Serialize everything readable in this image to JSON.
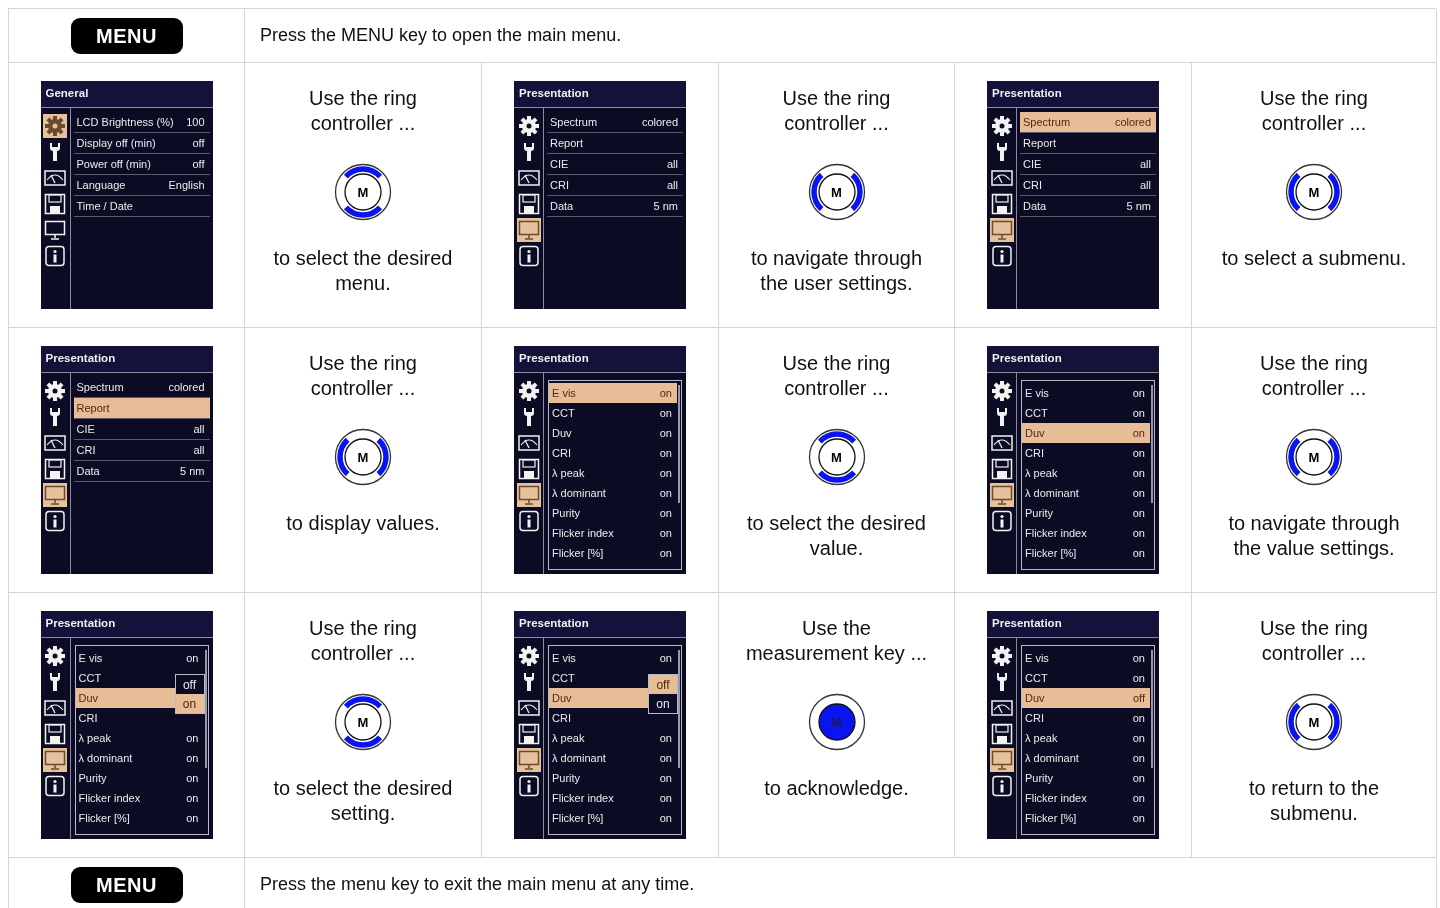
{
  "header": {
    "key_label": "MENU",
    "text": "Press the MENU key to open the main menu."
  },
  "steps": [
    {
      "screen": {
        "title": "General",
        "sidebar": [
          {
            "selected": true
          },
          {
            "selected": false
          },
          {
            "selected": false
          },
          {
            "selected": false
          },
          {
            "selected": false
          },
          {
            "selected": false
          }
        ],
        "kind": "plain",
        "rows": [
          {
            "label": "LCD Brightness (%)",
            "value": "100",
            "selected": false
          },
          {
            "label": "Display off (min)",
            "value": "off",
            "selected": false
          },
          {
            "label": "Power off (min)",
            "value": "off",
            "selected": false
          },
          {
            "label": "Language",
            "value": "English",
            "selected": false
          },
          {
            "label": "Time / Date",
            "selected": false
          }
        ]
      },
      "instruction": {
        "before": "Use the ring\ncontroller ...",
        "ring": {
          "kind": "vertical",
          "label": "M"
        },
        "after": "to select the desired\nmenu."
      }
    },
    {
      "screen": {
        "title": "Presentation",
        "sidebar": [
          {
            "selected": false
          },
          {
            "selected": false
          },
          {
            "selected": false
          },
          {
            "selected": false
          },
          {
            "selected": true
          },
          {
            "selected": false
          }
        ],
        "kind": "plain",
        "rows": [
          {
            "label": "Spectrum",
            "value": "colored",
            "selected": false
          },
          {
            "label": "Report",
            "selected": false
          },
          {
            "label": "CIE",
            "value": "all",
            "selected": false
          },
          {
            "label": "CRI",
            "value": "all",
            "selected": false
          },
          {
            "label": "Data",
            "value": "5 nm",
            "selected": false
          }
        ]
      },
      "instruction": {
        "before": "Use the ring\ncontroller ...",
        "ring": {
          "kind": "horizontal",
          "label": "M"
        },
        "after": "to navigate through\nthe user settings."
      }
    },
    {
      "screen": {
        "title": "Presentation",
        "sidebar": [
          {
            "selected": false
          },
          {
            "selected": false
          },
          {
            "selected": false
          },
          {
            "selected": false
          },
          {
            "selected": true
          },
          {
            "selected": false
          }
        ],
        "kind": "plain",
        "rows": [
          {
            "label": "Spectrum",
            "value": "colored",
            "selected": true
          },
          {
            "label": "Report",
            "selected": false
          },
          {
            "label": "CIE",
            "value": "all",
            "selected": false
          },
          {
            "label": "CRI",
            "value": "all",
            "selected": false
          },
          {
            "label": "Data",
            "value": "5 nm",
            "selected": false
          }
        ]
      },
      "instruction": {
        "before": "Use the ring\ncontroller ...",
        "ring": {
          "kind": "horizontal",
          "label": "M"
        },
        "after": "to select a submenu."
      }
    },
    {
      "screen": {
        "title": "Presentation",
        "sidebar": [
          {
            "selected": false
          },
          {
            "selected": false
          },
          {
            "selected": false
          },
          {
            "selected": false
          },
          {
            "selected": true
          },
          {
            "selected": false
          }
        ],
        "kind": "plain",
        "rows": [
          {
            "label": "Spectrum",
            "value": "colored",
            "selected": false
          },
          {
            "label": "Report",
            "selected": true
          },
          {
            "label": "CIE",
            "value": "all",
            "selected": false
          },
          {
            "label": "CRI",
            "value": "all",
            "selected": false
          },
          {
            "label": "Data",
            "value": "5 nm",
            "selected": false
          }
        ]
      },
      "instruction": {
        "before": "Use the ring\ncontroller ...",
        "ring": {
          "kind": "horizontal",
          "label": "M"
        },
        "after": "to display values."
      }
    },
    {
      "screen": {
        "title": "Presentation",
        "sidebar": [
          {
            "selected": false
          },
          {
            "selected": false
          },
          {
            "selected": false
          },
          {
            "selected": false
          },
          {
            "selected": true
          },
          {
            "selected": false
          }
        ],
        "kind": "boxed",
        "rows": [
          {
            "label": "E vis",
            "value": "on",
            "selected": true
          },
          {
            "label": "CCT",
            "value": "on",
            "selected": false
          },
          {
            "label": "Duv",
            "value": "on",
            "selected": false
          },
          {
            "label": "CRI",
            "value": "on",
            "selected": false
          },
          {
            "label": "λ peak",
            "value": "on",
            "selected": false
          },
          {
            "label": "λ dominant",
            "value": "on",
            "selected": false
          },
          {
            "label": "Purity",
            "value": "on",
            "selected": false
          },
          {
            "label": "Flicker index",
            "value": "on",
            "selected": false
          },
          {
            "label": "Flicker [%]",
            "value": "on",
            "selected": false
          }
        ]
      },
      "instruction": {
        "before": "Use the ring\ncontroller ...",
        "ring": {
          "kind": "vertical",
          "label": "M"
        },
        "after": "to select the desired\nvalue."
      }
    },
    {
      "screen": {
        "title": "Presentation",
        "sidebar": [
          {
            "selected": false
          },
          {
            "selected": false
          },
          {
            "selected": false
          },
          {
            "selected": false
          },
          {
            "selected": true
          },
          {
            "selected": false
          }
        ],
        "kind": "boxed",
        "rows": [
          {
            "label": "E vis",
            "value": "on",
            "selected": false
          },
          {
            "label": "CCT",
            "value": "on",
            "selected": false
          },
          {
            "label": "Duv",
            "value": "on",
            "selected": true
          },
          {
            "label": "CRI",
            "value": "on",
            "selected": false
          },
          {
            "label": "λ peak",
            "value": "on",
            "selected": false
          },
          {
            "label": "λ dominant",
            "value": "on",
            "selected": false
          },
          {
            "label": "Purity",
            "value": "on",
            "selected": false
          },
          {
            "label": "Flicker index",
            "value": "on",
            "selected": false
          },
          {
            "label": "Flicker [%]",
            "value": "on",
            "selected": false
          }
        ]
      },
      "instruction": {
        "before": "Use the ring\ncontroller ...",
        "ring": {
          "kind": "horizontal",
          "label": "M"
        },
        "after": "to navigate through\nthe value settings."
      }
    },
    {
      "screen": {
        "title": "Presentation",
        "sidebar": [
          {
            "selected": false
          },
          {
            "selected": false
          },
          {
            "selected": false
          },
          {
            "selected": false
          },
          {
            "selected": true
          },
          {
            "selected": false
          }
        ],
        "kind": "boxed",
        "rows": [
          {
            "label": "E vis",
            "value": "on",
            "selected": false
          },
          {
            "label": "CCT",
            "selected": false
          },
          {
            "label": "Duv",
            "selected": true
          },
          {
            "label": "CRI",
            "selected": false
          },
          {
            "label": "λ peak",
            "value": "on",
            "selected": false
          },
          {
            "label": "λ dominant",
            "value": "on",
            "selected": false
          },
          {
            "label": "Purity",
            "value": "on",
            "selected": false
          },
          {
            "label": "Flicker index",
            "value": "on",
            "selected": false
          },
          {
            "label": "Flicker [%]",
            "value": "on",
            "selected": false
          }
        ],
        "popup": [
          {
            "label": "off",
            "selected": false
          },
          {
            "label": "on",
            "selected": true
          }
        ]
      },
      "instruction": {
        "before": "Use the ring\ncontroller ...",
        "ring": {
          "kind": "vertical",
          "label": "M"
        },
        "after": "to select the desired\nsetting."
      }
    },
    {
      "screen": {
        "title": "Presentation",
        "sidebar": [
          {
            "selected": false
          },
          {
            "selected": false
          },
          {
            "selected": false
          },
          {
            "selected": false
          },
          {
            "selected": true
          },
          {
            "selected": false
          }
        ],
        "kind": "boxed",
        "rows": [
          {
            "label": "E vis",
            "value": "on",
            "selected": false
          },
          {
            "label": "CCT",
            "selected": false
          },
          {
            "label": "Duv",
            "selected": true
          },
          {
            "label": "CRI",
            "selected": false
          },
          {
            "label": "λ peak",
            "value": "on",
            "selected": false
          },
          {
            "label": "λ dominant",
            "value": "on",
            "selected": false
          },
          {
            "label": "Purity",
            "value": "on",
            "selected": false
          },
          {
            "label": "Flicker index",
            "value": "on",
            "selected": false
          },
          {
            "label": "Flicker [%]",
            "value": "on",
            "selected": false
          }
        ],
        "popup": [
          {
            "label": "off",
            "selected": true
          },
          {
            "label": "on",
            "selected": false
          }
        ]
      },
      "instruction": {
        "before": "Use the\nmeasurement key ...",
        "ring": {
          "kind": "pressed",
          "label": "M"
        },
        "after": "to acknowledge."
      }
    },
    {
      "screen": {
        "title": "Presentation",
        "sidebar": [
          {
            "selected": false
          },
          {
            "selected": false
          },
          {
            "selected": false
          },
          {
            "selected": false
          },
          {
            "selected": true
          },
          {
            "selected": false
          }
        ],
        "kind": "boxed",
        "rows": [
          {
            "label": "E vis",
            "value": "on",
            "selected": false
          },
          {
            "label": "CCT",
            "value": "on",
            "selected": false
          },
          {
            "label": "Duv",
            "value": "off",
            "selected": true
          },
          {
            "label": "CRI",
            "value": "on",
            "selected": false
          },
          {
            "label": "λ peak",
            "value": "on",
            "selected": false
          },
          {
            "label": "λ dominant",
            "value": "on",
            "selected": false
          },
          {
            "label": "Purity",
            "value": "on",
            "selected": false
          },
          {
            "label": "Flicker index",
            "value": "on",
            "selected": false
          },
          {
            "label": "Flicker [%]",
            "value": "on",
            "selected": false
          }
        ]
      },
      "instruction": {
        "before": "Use the ring\ncontroller ...",
        "ring": {
          "kind": "horizontal",
          "label": "M"
        },
        "after": "to return to the\nsubmenu."
      }
    }
  ],
  "footer": {
    "key_label": "MENU",
    "text": "Press the menu key to exit the main menu at any time."
  }
}
